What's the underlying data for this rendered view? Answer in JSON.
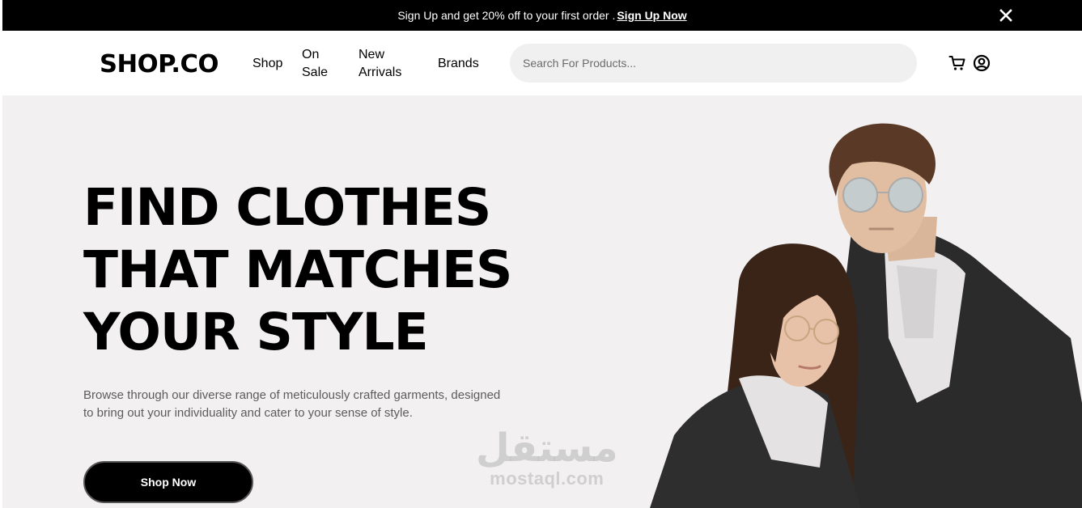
{
  "promo": {
    "text": "Sign Up and get 20% off to your first order .",
    "link": "Sign Up Now",
    "close": "X"
  },
  "nav": {
    "logo": "SHOP.CO",
    "links": [
      "Shop",
      "On",
      "Sale",
      "New",
      "Arrivals",
      "Brands"
    ],
    "search_placeholder": "Search For Products...",
    "icons": [
      "cart-icon",
      "user-icon"
    ]
  },
  "hero": {
    "title_lines": [
      "FIND CLOTHES",
      "THAT MATCHES",
      "YOUR STYLE"
    ],
    "description_lines": [
      "Browse through our diverse range of meticulously crafted garments, designed",
      "to bring out your individuality and cater to your sense of style."
    ],
    "button": "Shop Now"
  },
  "watermark": {
    "arabic": "مستقل",
    "latin": "mostaql.com"
  },
  "colors": {
    "promo_bg": "#000000",
    "hero_bg": "#f2f0f1",
    "search_bg": "#f0f0f0",
    "text": "#000000",
    "muted": "#5c5c5c"
  }
}
